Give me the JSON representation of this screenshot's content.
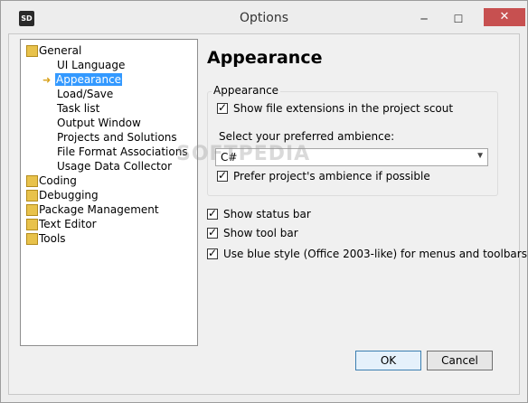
{
  "window": {
    "title": "Options",
    "app_icon_text": "SD",
    "minimize_glyph": "─",
    "maximize_glyph": "☐",
    "close_glyph": "✕"
  },
  "tree": {
    "items": [
      {
        "label": "General",
        "level": 0,
        "icon": "folder-icon"
      },
      {
        "label": "UI Language",
        "level": 1
      },
      {
        "label": "Appearance",
        "level": 1,
        "selected": true,
        "icon": "arrow-right-icon"
      },
      {
        "label": "Load/Save",
        "level": 1
      },
      {
        "label": "Task list",
        "level": 1
      },
      {
        "label": "Output Window",
        "level": 1
      },
      {
        "label": "Projects and Solutions",
        "level": 1
      },
      {
        "label": "File Format Associations",
        "level": 1
      },
      {
        "label": "Usage Data Collector",
        "level": 1
      },
      {
        "label": "Coding",
        "level": 0,
        "icon": "folder-icon"
      },
      {
        "label": "Debugging",
        "level": 0,
        "icon": "folder-icon"
      },
      {
        "label": "Package Management",
        "level": 0,
        "icon": "folder-icon"
      },
      {
        "label": "Text Editor",
        "level": 0,
        "icon": "folder-icon"
      },
      {
        "label": "Tools",
        "level": 0,
        "icon": "folder-icon"
      }
    ]
  },
  "panel": {
    "heading": "Appearance",
    "group_title": "Appearance",
    "show_extensions": {
      "label": "Show file extensions in the project scout",
      "checked": true
    },
    "ambience_label": "Select your preferred ambience:",
    "ambience_value": "C#",
    "prefer_project": {
      "label": "Prefer project's ambience if possible",
      "checked": true
    },
    "show_status_bar": {
      "label": "Show status bar",
      "checked": true
    },
    "show_tool_bar": {
      "label": "Show tool bar",
      "checked": true
    },
    "blue_style": {
      "label": "Use blue style (Office 2003-like) for menus and toolbars.",
      "checked": true
    }
  },
  "buttons": {
    "ok": "OK",
    "cancel": "Cancel"
  },
  "watermark": "SOFTPEDIA"
}
